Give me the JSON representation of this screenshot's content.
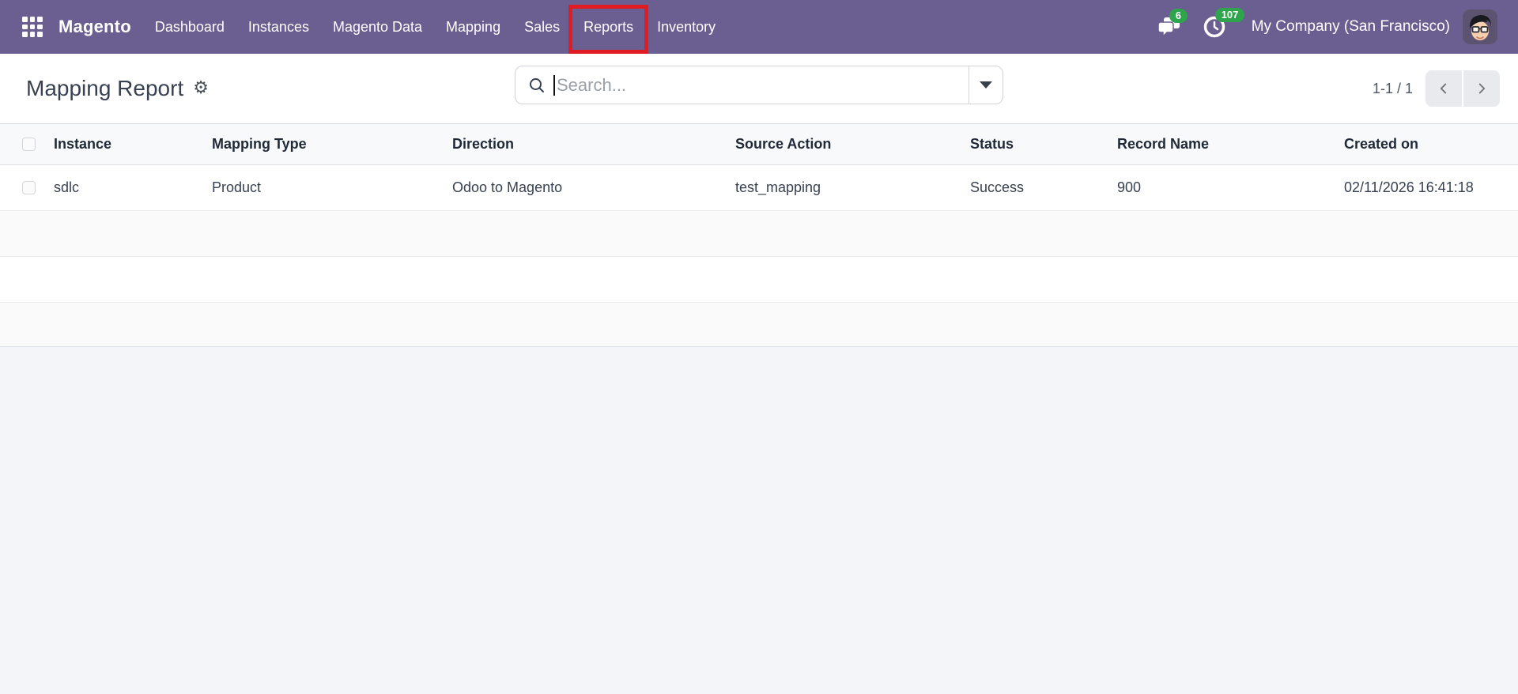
{
  "navbar": {
    "brand": "Magento",
    "items": [
      "Dashboard",
      "Instances",
      "Magento Data",
      "Mapping",
      "Sales",
      "Reports",
      "Inventory"
    ],
    "highlighted_item": "Reports",
    "messages_badge": "6",
    "activities_badge": "107",
    "company": "My Company (San Francisco)"
  },
  "control_panel": {
    "title": "Mapping Report",
    "search_placeholder": "Search...",
    "pager_value": "1-1 / 1"
  },
  "table": {
    "headers": [
      "Instance",
      "Mapping Type",
      "Direction",
      "Source Action",
      "Status",
      "Record Name",
      "Created on"
    ],
    "rows": [
      {
        "instance": "sdlc",
        "mapping_type": "Product",
        "direction": "Odoo to Magento",
        "source_action": "test_mapping",
        "status": "Success",
        "record_name": "900",
        "created_on": "02/11/2026 16:41:18"
      }
    ]
  },
  "colors": {
    "navbar_bg": "#6b5e90",
    "badge_green": "#2ea44c",
    "highlight_red": "#e01b22",
    "page_bg": "#f3f5f8"
  }
}
